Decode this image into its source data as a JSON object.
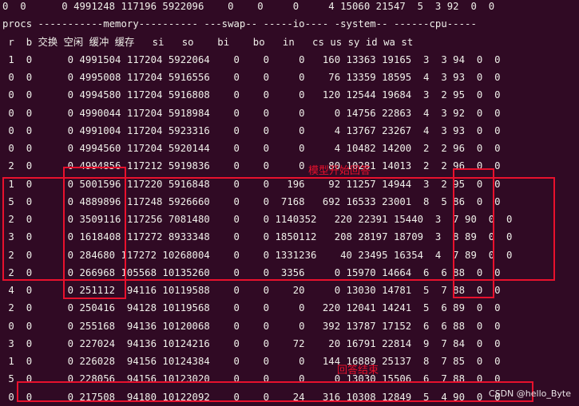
{
  "terminal": {
    "colors": {
      "background": "#300a24",
      "foreground": "#f0f0ea",
      "annotation": "#e8112d"
    },
    "lines": [
      "0  0      0 4991248 117196 5922096    0    0     0     4 15060 21547  5  3 92  0  0",
      "procs -----------memory---------- ---swap-- -----io---- -system-- ------cpu-----",
      " r  b 交换 空闲 缓冲 缓存   si   so    bi    bo   in   cs us sy id wa st",
      " 1  0      0 4991504 117204 5922064    0    0     0   160 13363 19165  3  3 94  0  0",
      " 0  0      0 4995008 117204 5916556    0    0     0    76 13359 18595  4  3 93  0  0",
      " 0  0      0 4994580 117204 5916808    0    0     0   120 12544 19684  3  2 95  0  0",
      " 0  0      0 4990044 117204 5918984    0    0     0     0 14756 22863  4  3 92  0  0",
      " 0  0      0 4991004 117204 5923316    0    0     0     4 13767 23267  4  3 93  0  0",
      " 0  0      0 4994560 117204 5920144    0    0     0     4 10482 14200  2  2 96  0  0",
      " 2  0      0 4994856 117212 5919836    0    0     0    80 10281 14013  2  2 96  0  0",
      " 1  0      0 5001596 117220 5916848    0    0   196    92 11257 14944  3  2 95  0  0",
      " 5  0      0 4889896 117248 5926660    0    0  7168   692 16533 23001  8  5 86  0  0",
      " 2  0      0 3509116 117256 7081480    0    0 1140352   220 22391 15440  3  7 90  0  0",
      " 3  0      0 1618408 117272 8933348    0    0 1850112   208 28197 18709  3  8 89  0  0",
      " 2  0      0 284680 117272 10268004    0    0 1331236    40 23495 16354  4  7 89  0  0",
      " 2  0      0 266968 105568 10135260    0    0  3356     0 15970 14664  6  6 88  0  0",
      " 4  0      0 251112  94116 10119588    0    0    20     0 13030 14781  5  7 88  0  0",
      " 2  0      0 250416  94128 10119568    0    0     0   220 12041 14241  5  6 89  0  0",
      " 0  0      0 255168  94136 10120068    0    0     0   392 13787 17152  6  6 88  0  0",
      " 3  0      0 227024  94136 10124216    0    0    72    20 16791 22814  9  7 84  0  0",
      " 1  0      0 226028  94156 10124384    0    0     0   144 16889 25137  8  7 85  0  0",
      " 5  0      0 228056  94156 10123020    0    0     0     0 13030 15506  6  7 88  0  0",
      " 0  0      0 217508  94180 10122092    0    0    24   316 10308 12849  5  4 90  0  0"
    ]
  },
  "annotations": {
    "answer_start": "模型开始回答",
    "answer_end": "回答结束"
  },
  "watermark": "CSDN @hello_Byte"
}
